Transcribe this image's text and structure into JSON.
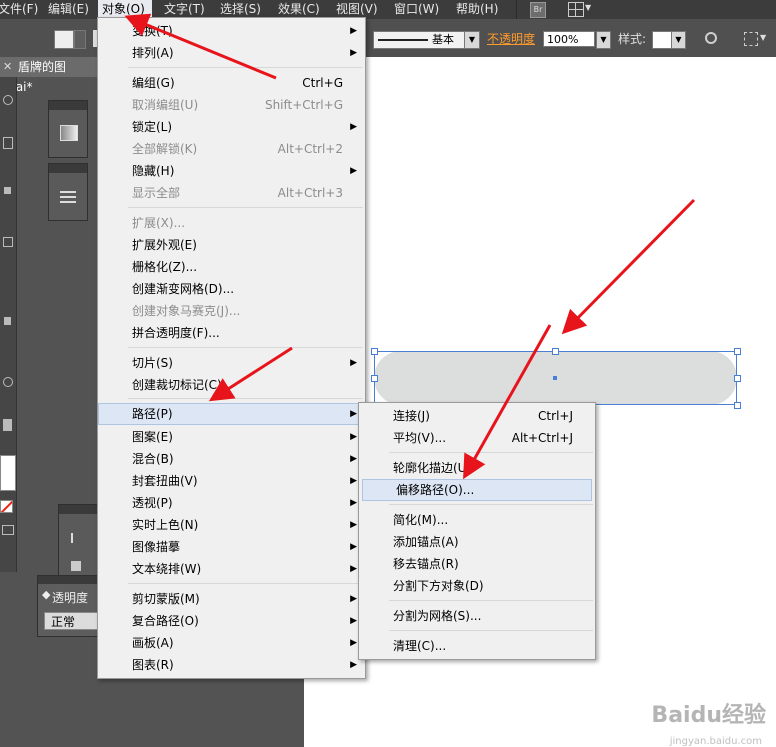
{
  "menubar": {
    "items": [
      "文件(F)",
      "编辑(E)",
      "对象(O)",
      "文字(T)",
      "选择(S)",
      "效果(C)",
      "视图(V)",
      "窗口(W)",
      "帮助(H)"
    ],
    "br_label": "Br"
  },
  "controlbar": {
    "stroke_style": "基本",
    "opacity_label": "不透明度",
    "opacity_value": "100%",
    "style_label": "样式:"
  },
  "document": {
    "tab_title": "盾牌的图标.ai*"
  },
  "transparency_panel": {
    "title": "透明度",
    "blend_mode": "正常"
  },
  "object_menu": {
    "groups": [
      [
        {
          "label": "变换(T)",
          "submenu": true
        },
        {
          "label": "排列(A)",
          "submenu": true
        }
      ],
      [
        {
          "label": "编组(G)",
          "shortcut": "Ctrl+G"
        },
        {
          "label": "取消编组(U)",
          "shortcut": "Shift+Ctrl+G",
          "disabled": true
        },
        {
          "label": "锁定(L)",
          "submenu": true
        },
        {
          "label": "全部解锁(K)",
          "shortcut": "Alt+Ctrl+2",
          "disabled": true
        },
        {
          "label": "隐藏(H)",
          "submenu": true
        },
        {
          "label": "显示全部",
          "shortcut": "Alt+Ctrl+3",
          "disabled": true
        }
      ],
      [
        {
          "label": "扩展(X)...",
          "disabled": true
        },
        {
          "label": "扩展外观(E)"
        },
        {
          "label": "栅格化(Z)..."
        },
        {
          "label": "创建渐变网格(D)..."
        },
        {
          "label": "创建对象马赛克(J)...",
          "disabled": true
        },
        {
          "label": "拼合透明度(F)..."
        }
      ],
      [
        {
          "label": "切片(S)",
          "submenu": true
        },
        {
          "label": "创建裁切标记(C)"
        }
      ],
      [
        {
          "label": "路径(P)",
          "submenu": true,
          "highlighted": true
        },
        {
          "label": "图案(E)",
          "submenu": true
        },
        {
          "label": "混合(B)",
          "submenu": true
        },
        {
          "label": "封套扭曲(V)",
          "submenu": true
        },
        {
          "label": "透视(P)",
          "submenu": true
        },
        {
          "label": "实时上色(N)",
          "submenu": true
        },
        {
          "label": "图像描摹",
          "submenu": true
        },
        {
          "label": "文本绕排(W)",
          "submenu": true
        }
      ],
      [
        {
          "label": "剪切蒙版(M)",
          "submenu": true
        },
        {
          "label": "复合路径(O)",
          "submenu": true
        },
        {
          "label": "画板(A)",
          "submenu": true
        },
        {
          "label": "图表(R)",
          "submenu": true
        }
      ]
    ]
  },
  "path_submenu": {
    "groups": [
      [
        {
          "label": "连接(J)",
          "shortcut": "Ctrl+J"
        },
        {
          "label": "平均(V)...",
          "shortcut": "Alt+Ctrl+J"
        }
      ],
      [
        {
          "label": "轮廓化描边(U)"
        },
        {
          "label": "偏移路径(O)...",
          "highlighted": true
        }
      ],
      [
        {
          "label": "简化(M)..."
        },
        {
          "label": "添加锚点(A)"
        },
        {
          "label": "移去锚点(R)"
        },
        {
          "label": "分割下方对象(D)"
        }
      ],
      [
        {
          "label": "分割为网格(S)..."
        }
      ],
      [
        {
          "label": "清理(C)..."
        }
      ]
    ]
  },
  "watermark": {
    "brand": "Baidu经验",
    "url": "jingyan.baidu.com"
  },
  "colors": {
    "arrow": "#e8141b",
    "highlight": "#dce6f4",
    "selection": "#4a7fd6"
  }
}
